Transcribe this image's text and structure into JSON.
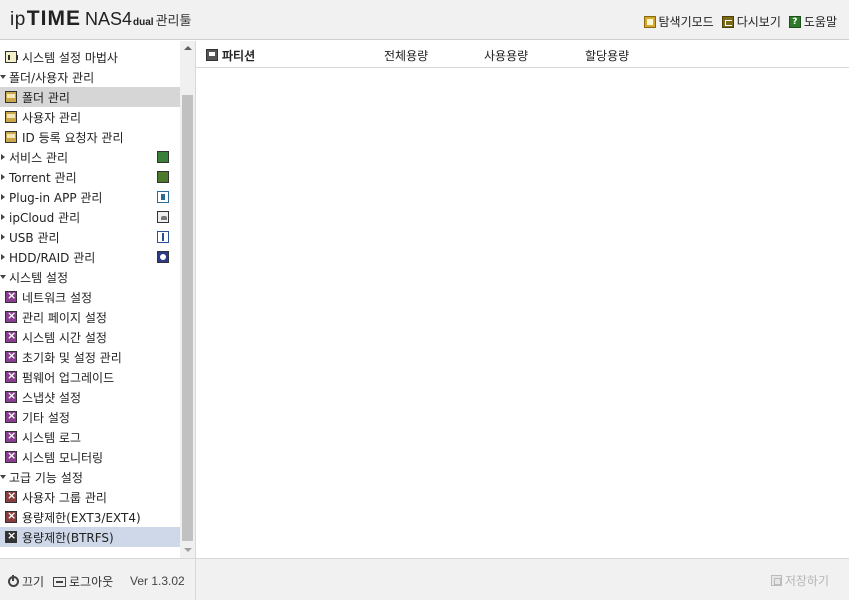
{
  "header": {
    "logo": {
      "ip": "ip",
      "time": "TIME",
      "model": "NAS4",
      "dual": "dual",
      "suffix": "관리툴"
    },
    "links": [
      {
        "label": "탐색기모드",
        "icon": "explorer-icon"
      },
      {
        "label": "다시보기",
        "icon": "reload-icon"
      },
      {
        "label": "도움말",
        "icon": "help-icon"
      }
    ]
  },
  "sidebar": {
    "items": [
      {
        "label": "시스템 설정 마법사",
        "level": "sub",
        "icon": "wizard-icon"
      },
      {
        "label": "폴더/사용자 관리",
        "level": "top",
        "open": true
      },
      {
        "label": "폴더 관리",
        "level": "sub",
        "icon": "folder-icon",
        "selected": true
      },
      {
        "label": "사용자 관리",
        "level": "sub",
        "icon": "folder-icon"
      },
      {
        "label": "ID 등록 요청자 관리",
        "level": "sub",
        "icon": "folder-icon"
      },
      {
        "label": "서비스 관리",
        "level": "top",
        "rightIcon": "service-icon"
      },
      {
        "label": "Torrent 관리",
        "level": "top",
        "rightIcon": "torrent-icon"
      },
      {
        "label": "Plug-in APP 관리",
        "level": "top",
        "rightIcon": "plugin-icon"
      },
      {
        "label": "ipCloud 관리",
        "level": "top",
        "rightIcon": "cloud-icon"
      },
      {
        "label": "USB 관리",
        "level": "top",
        "rightIcon": "usb-icon"
      },
      {
        "label": "HDD/RAID 관리",
        "level": "top",
        "rightIcon": "hdd-icon"
      },
      {
        "label": "시스템 설정",
        "level": "top",
        "open": true
      },
      {
        "label": "네트워크 설정",
        "level": "sub",
        "icon": "system-icon"
      },
      {
        "label": "관리 페이지 설정",
        "level": "sub",
        "icon": "system-icon"
      },
      {
        "label": "시스템 시간 설정",
        "level": "sub",
        "icon": "system-icon"
      },
      {
        "label": "초기화 및 설정 관리",
        "level": "sub",
        "icon": "system-icon"
      },
      {
        "label": "펌웨어 업그레이드",
        "level": "sub",
        "icon": "system-icon"
      },
      {
        "label": "스냅샷 설정",
        "level": "sub",
        "icon": "system-icon"
      },
      {
        "label": "기타 설정",
        "level": "sub",
        "icon": "system-icon"
      },
      {
        "label": "시스템 로그",
        "level": "sub",
        "icon": "system-icon"
      },
      {
        "label": "시스템 모니터링",
        "level": "sub",
        "icon": "system-icon"
      },
      {
        "label": "고급 기능 설정",
        "level": "top",
        "open": true
      },
      {
        "label": "사용자 그룹 관리",
        "level": "sub",
        "icon": "advanced-icon"
      },
      {
        "label": "용량제한(EXT3/EXT4)",
        "level": "sub",
        "icon": "advanced-icon"
      },
      {
        "label": "용량제한(BTRFS)",
        "level": "sub",
        "icon": "quota-icon",
        "highlighted": true
      }
    ]
  },
  "main": {
    "columns": [
      "파티션",
      "전체용량",
      "사용용량",
      "할당용량"
    ]
  },
  "footer": {
    "power_label": "끄기",
    "logout_label": "로그아웃",
    "version": "Ver 1.3.02",
    "save_label": "저장하기"
  }
}
